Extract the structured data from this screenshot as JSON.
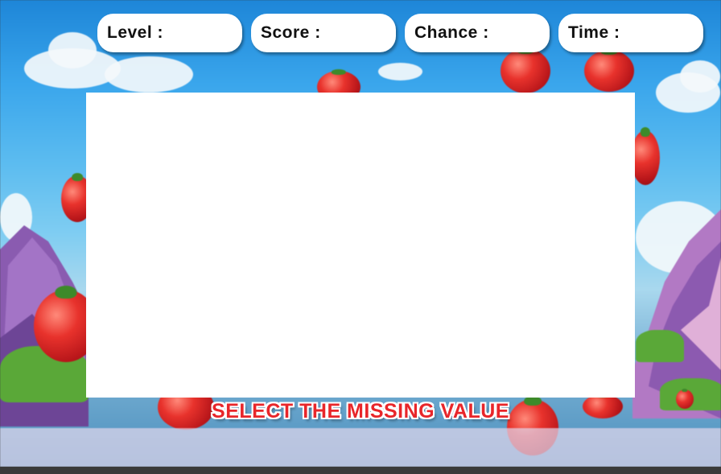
{
  "hud": {
    "level_label": "Level :",
    "score_label": "Score :",
    "chance_label": "Chance :",
    "time_label": "Time :"
  },
  "instruction": "SELECT THE MISSING VALUE",
  "colors": {
    "instruction_text": "#e8262a",
    "hud_background": "#ffffff",
    "board_background": "#ffffff"
  }
}
